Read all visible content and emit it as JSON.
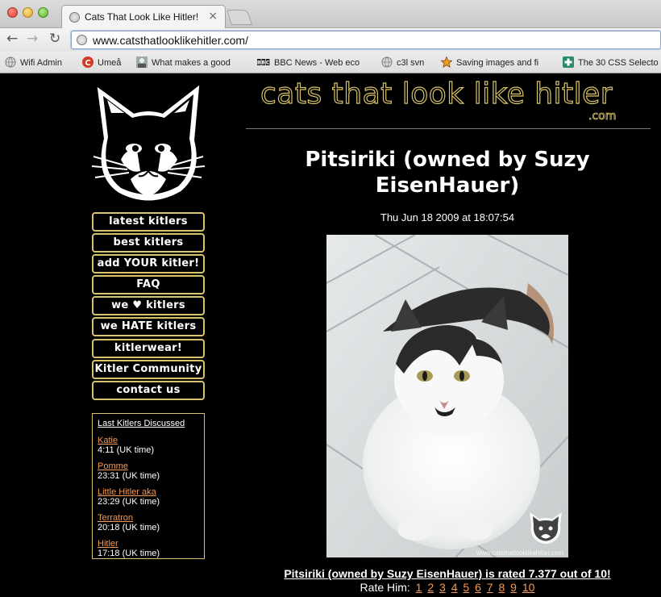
{
  "browser": {
    "tab_title": "Cats That Look Like Hitler!",
    "tab_close": "×",
    "url": "www.catsthatlooklikehitler.com/",
    "nav": {
      "back": "←",
      "forward": "→",
      "reload": "↻"
    },
    "bookmarks": [
      {
        "label": "Wifi Admin",
        "icon": "globe-icon"
      },
      {
        "label": "Umeå",
        "icon": "c-logo-icon"
      },
      {
        "label": "What makes a good",
        "icon": "avatar-icon"
      },
      {
        "label": "BBC News - Web eco",
        "icon": "bbc-icon"
      },
      {
        "label": "c3l svn",
        "icon": "globe-icon"
      },
      {
        "label": "Saving images and fi",
        "icon": "star-icon"
      },
      {
        "label": "The 30 CSS Selecto",
        "icon": "plus-icon"
      }
    ]
  },
  "site": {
    "title": "cats that look like hitler",
    "title_suffix": ".com"
  },
  "menu": [
    "latest kitlers",
    "best kitlers",
    "add YOUR kitler!",
    "FAQ",
    "we ♥ kitlers",
    "we HATE kitlers",
    "kitlerwear!",
    "Kitler Community",
    "contact us"
  ],
  "recent": {
    "title": "Last Kitlers Discussed",
    "items": [
      {
        "name": "Katie",
        "time": "4:11 (UK time)"
      },
      {
        "name": "Pomme",
        "time": "23:31 (UK time)"
      },
      {
        "name": "Little Hitler aka",
        "time": "23:29 (UK time)"
      },
      {
        "name": "Terratron",
        "time": "20:18 (UK time)"
      },
      {
        "name": "Hitler",
        "time": "17:18 (UK time)"
      }
    ]
  },
  "kitler": {
    "name": "Pitsiriki (owned by Suzy EisenHauer)",
    "date": "Thu Jun 18 2009 at 18:07:54",
    "watermark": "www.catsthatlooklikehitler.com",
    "rating_text": "Pitsiriki (owned by Suzy EisenHauer) is rated 7.377 out of 10!",
    "rate_label": "Rate Him:",
    "rate_options": [
      "1",
      "2",
      "3",
      "4",
      "5",
      "6",
      "7",
      "8",
      "9",
      "10"
    ]
  },
  "colors": {
    "accent": "#d8c36a",
    "link": "#f39a54",
    "background": "#000000"
  }
}
